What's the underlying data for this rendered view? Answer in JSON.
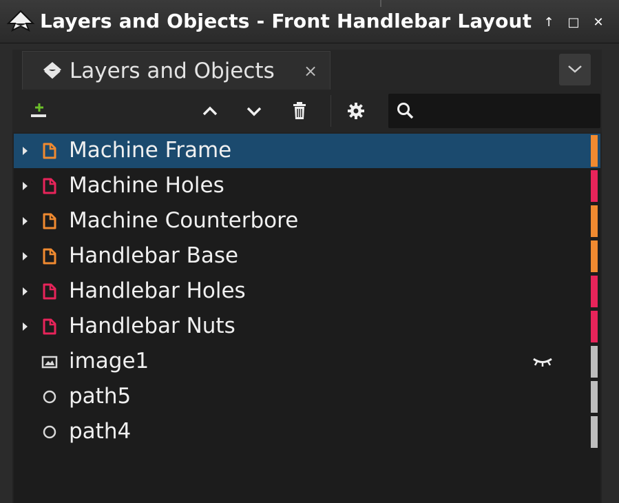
{
  "window": {
    "title": "Layers and Objects - Front Handlebar Layout",
    "controls": [
      "↑",
      "□",
      "✕"
    ]
  },
  "tab": {
    "label": "Layers and Objects",
    "close": "×"
  },
  "toolbar": {
    "search_placeholder": "",
    "search_value": ""
  },
  "items": [
    {
      "label": "Machine Frame",
      "kind": "layer",
      "color": "#f08a30",
      "expandable": true,
      "selected": true
    },
    {
      "label": "Machine Holes",
      "kind": "layer",
      "color": "#e8245a",
      "expandable": true,
      "selected": false
    },
    {
      "label": "Machine Counterbore",
      "kind": "layer",
      "color": "#f08a30",
      "expandable": true,
      "selected": false
    },
    {
      "label": "Handlebar Base",
      "kind": "layer",
      "color": "#f08a30",
      "expandable": true,
      "selected": false
    },
    {
      "label": "Handlebar Holes",
      "kind": "layer",
      "color": "#e8245a",
      "expandable": true,
      "selected": false
    },
    {
      "label": "Handlebar Nuts",
      "kind": "layer",
      "color": "#e8245a",
      "expandable": true,
      "selected": false
    },
    {
      "label": "image1",
      "kind": "image",
      "color": "#bdbdbd",
      "expandable": false,
      "selected": false,
      "hidden": true
    },
    {
      "label": "path5",
      "kind": "path",
      "color": "#bdbdbd",
      "expandable": false,
      "selected": false
    },
    {
      "label": "path4",
      "kind": "path",
      "color": "#bdbdbd",
      "expandable": false,
      "selected": false
    }
  ],
  "colors": {
    "selection": "#1b4a6e",
    "orange_layer": "#f08a30",
    "red_layer": "#e8245a",
    "object_tag": "#bdbdbd"
  }
}
